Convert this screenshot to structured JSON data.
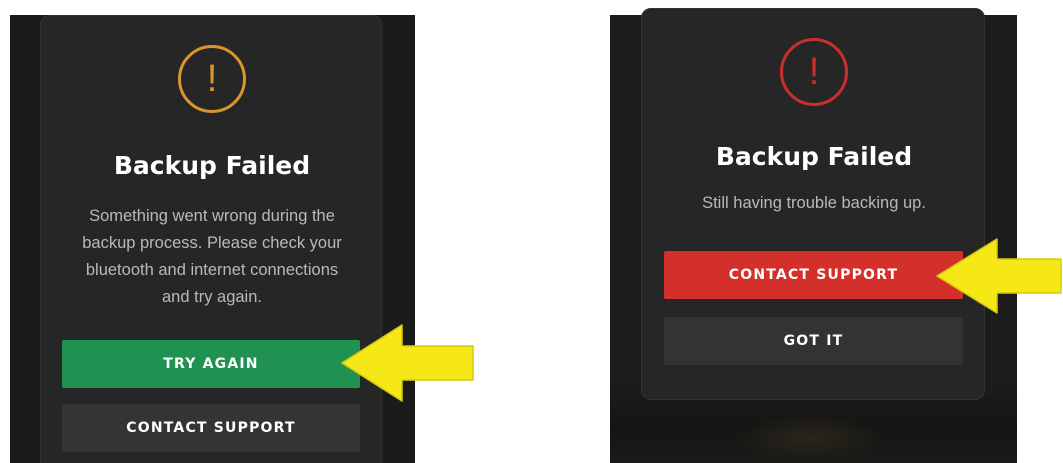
{
  "left_dialog": {
    "title": "Backup Failed",
    "message_lines": [
      "Something went wrong during the",
      "backup process. Please check your",
      "bluetooth and internet connections",
      "and try again."
    ],
    "alert_glyph": "!",
    "alert_icon": "exclamation-circle-icon",
    "alert_color": "#d99629",
    "primary_button_label": "TRY AGAIN",
    "primary_button_color": "#1f9151",
    "secondary_button_label": "CONTACT SUPPORT"
  },
  "right_dialog": {
    "title": "Backup Failed",
    "message": "Still having trouble backing up.",
    "alert_glyph": "!",
    "alert_icon": "exclamation-circle-icon",
    "alert_color": "#c9302c",
    "primary_button_label": "CONTACT SUPPORT",
    "primary_button_color": "#d4302b",
    "secondary_button_label": "GOT IT"
  },
  "annotations": {
    "arrow_icon": "left-pointing-arrow-icon",
    "arrow_color": "#f6e717"
  }
}
